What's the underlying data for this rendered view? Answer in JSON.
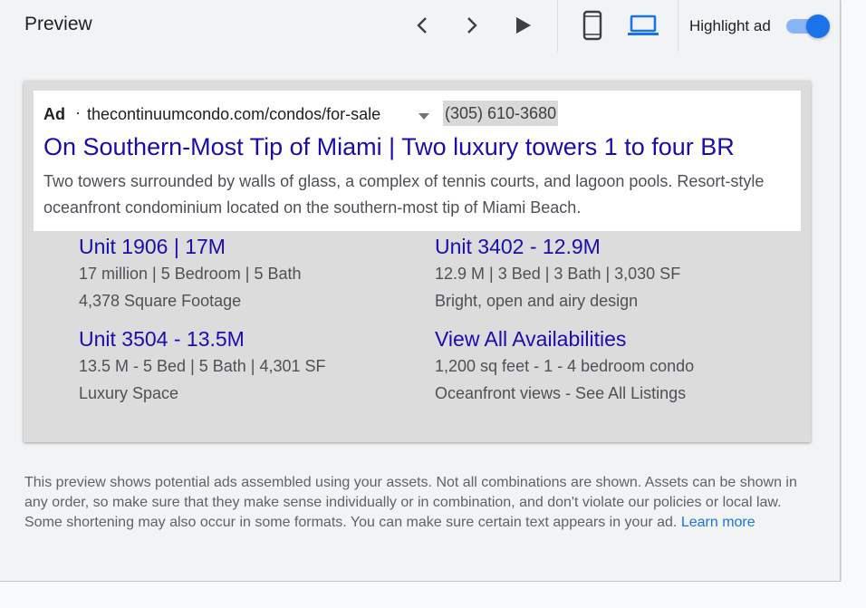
{
  "header": {
    "title": "Preview",
    "highlight_label": "Highlight ad",
    "highlight_on": true,
    "nav_icons": [
      "chevron-left-icon",
      "chevron-right-icon",
      "play-icon"
    ],
    "device_icons": [
      "smartphone-icon",
      "laptop-icon"
    ],
    "accent_color": "#1a73e8"
  },
  "ad": {
    "label": "Ad",
    "separator": "·",
    "display_url": "thecontinuumcondo.com/condos/for-sale",
    "phone": "(305) 610-3680",
    "headline": "On Southern-Most Tip of Miami | Two luxury towers 1 to four BR",
    "description": "Two towers surrounded by walls of glass, a complex of tennis courts, and lagoon pools. Resort-style oceanfront condominium located on the southern-most tip of Miami Beach.",
    "headline_color": "#1a0dab",
    "sitelinks": [
      {
        "title": "Unit 1906 | 17M",
        "line1": "17 million | 5 Bedroom | 5 Bath",
        "line2": "4,378 Square Footage"
      },
      {
        "title": "Unit 3402 - 12.9M",
        "line1": "12.9 M | 3 Bed | 3 Bath | 3,030 SF",
        "line2": "Bright, open and airy design"
      },
      {
        "title": "Unit 3504 - 13.5M",
        "line1": "13.5 M - 5 Bed | 5 Bath | 4,301 SF",
        "line2": "Luxury Space"
      },
      {
        "title": "View All Availabilities",
        "line1": "1,200 sq feet - 1 - 4 bedroom condo",
        "line2": "Oceanfront views - See All Listings"
      }
    ]
  },
  "footer": {
    "text": "This preview shows potential ads assembled using your assets. Not all combinations are shown. Assets can be shown in any order, so make sure that they make sense individually or in combination, and don't violate our policies or local law. Some shortening may also occur in some formats. You can make sure certain text appears in your ad.",
    "learn_more": "Learn more"
  }
}
